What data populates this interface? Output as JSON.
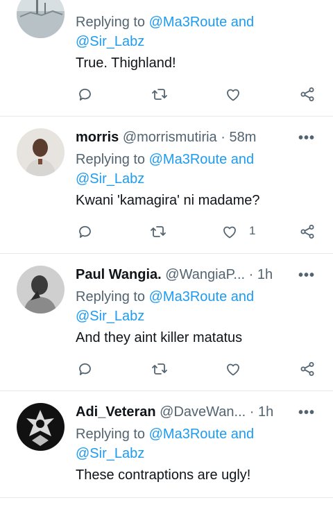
{
  "tweets": [
    {
      "name": "",
      "handle": "",
      "time": "",
      "replying_prefix": "Replying to",
      "mention1": "@Ma3Route and",
      "mention2": "@Sir_Labz",
      "text": "True. Thighland!",
      "likes": ""
    },
    {
      "name": "morris",
      "handle": "@morrismutiria",
      "time": "· 58m",
      "replying_prefix": "Replying to",
      "mention1": "@Ma3Route and",
      "mention2": "@Sir_Labz",
      "text": "Kwani 'kamagira' ni madame?",
      "likes": "1"
    },
    {
      "name": "Paul Wangia.",
      "handle": "@WangiaP...",
      "time": "· 1h",
      "replying_prefix": "Replying to",
      "mention1": "@Ma3Route and",
      "mention2": "@Sir_Labz",
      "text": "And they aint killer matatus",
      "likes": ""
    },
    {
      "name": "Adi_Veteran",
      "handle": "@DaveWan...",
      "time": "· 1h",
      "replying_prefix": "Replying to",
      "mention1": "@Ma3Route and",
      "mention2": "@Sir_Labz",
      "text": "These contraptions are ugly!",
      "likes": ""
    }
  ],
  "more_glyph": "•••",
  "icons": [
    "reply-icon",
    "retweet-icon",
    "like-icon",
    "share-icon"
  ],
  "colors": {
    "mention": "#1d9bf0",
    "muted": "#536471",
    "text": "#0f1419"
  }
}
